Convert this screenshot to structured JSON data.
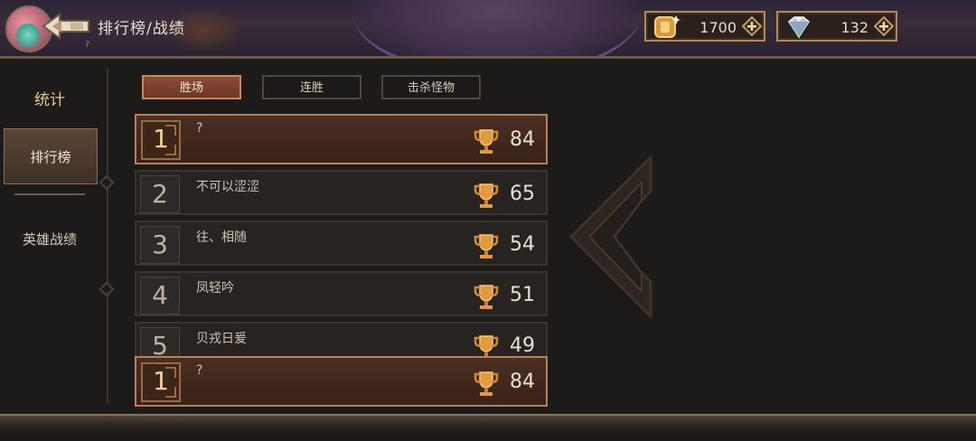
{
  "header": {
    "title": "排行榜/战绩",
    "subtitle": "?",
    "gold": {
      "value": "1700",
      "icon": "gold-coin-icon"
    },
    "gems": {
      "value": "132",
      "icon": "diamond-icon"
    }
  },
  "sidebar": {
    "items": [
      {
        "label": "统计"
      },
      {
        "label": "排行榜"
      },
      {
        "label": "英雄战绩"
      }
    ]
  },
  "tabs": [
    {
      "label": "胜场",
      "active": true
    },
    {
      "label": "连胜",
      "active": false
    },
    {
      "label": "击杀怪物",
      "active": false
    }
  ],
  "leaderboard": [
    {
      "rank": "1",
      "name": "?",
      "score": "84",
      "is_me": true
    },
    {
      "rank": "2",
      "name": "不可以涩涩",
      "score": "65"
    },
    {
      "rank": "3",
      "name": "往、相随",
      "score": "54"
    },
    {
      "rank": "4",
      "name": "凤轻吟",
      "score": "51"
    },
    {
      "rank": "5",
      "name": "贝戎日爰",
      "score": "49"
    }
  ],
  "my_rank": {
    "rank": "1",
    "name": "?",
    "score": "84"
  },
  "colors": {
    "accent": "#b5835a",
    "tab_active": "#8c4c34",
    "gold": "#e3c98e"
  }
}
